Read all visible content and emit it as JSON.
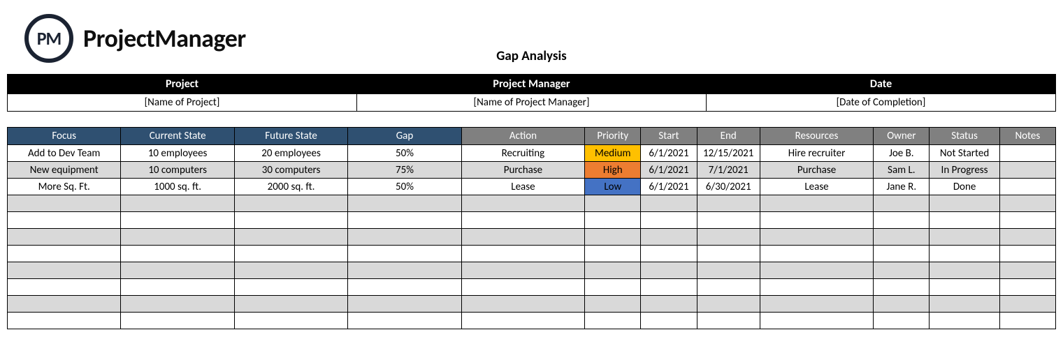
{
  "brand": {
    "logo_abbrev": "PM",
    "name": "ProjectManager"
  },
  "title": "Gap Analysis",
  "meta": {
    "headers": [
      "Project",
      "Project Manager",
      "Date"
    ],
    "values": [
      "[Name of Project]",
      "[Name of Project Manager]",
      "[Date of Completion]"
    ]
  },
  "columns": [
    {
      "key": "focus",
      "label": "Focus",
      "group": "blue"
    },
    {
      "key": "current",
      "label": "Current State",
      "group": "blue"
    },
    {
      "key": "future",
      "label": "Future State",
      "group": "blue"
    },
    {
      "key": "gap",
      "label": "Gap",
      "group": "blue"
    },
    {
      "key": "action",
      "label": "Action",
      "group": "gray"
    },
    {
      "key": "priority",
      "label": "Priority",
      "group": "gray"
    },
    {
      "key": "start",
      "label": "Start",
      "group": "gray"
    },
    {
      "key": "end",
      "label": "End",
      "group": "gray"
    },
    {
      "key": "resources",
      "label": "Resources",
      "group": "gray"
    },
    {
      "key": "owner",
      "label": "Owner",
      "group": "gray"
    },
    {
      "key": "status",
      "label": "Status",
      "group": "gray"
    },
    {
      "key": "notes",
      "label": "Notes",
      "group": "gray"
    }
  ],
  "rows": [
    {
      "stripe": "white",
      "focus": "Add to Dev Team",
      "current": "10 employees",
      "future": "20 employees",
      "gap": "50%",
      "action": "Recruiting",
      "priority": "Medium",
      "priority_color": "medium",
      "start": "6/1/2021",
      "end": "12/15/2021",
      "resources": "Hire recruiter",
      "owner": "Joe B.",
      "status": "Not Started",
      "notes": ""
    },
    {
      "stripe": "gray",
      "focus": "New equipment",
      "current": "10 computers",
      "future": "30 computers",
      "gap": "75%",
      "action": "Purchase",
      "priority": "High",
      "priority_color": "high",
      "start": "6/1/2021",
      "end": "7/1/2021",
      "resources": "Purchase",
      "owner": "Sam L.",
      "status": "In Progress",
      "notes": ""
    },
    {
      "stripe": "white",
      "focus": "More Sq. Ft.",
      "current": "1000 sq. ft.",
      "future": "2000 sq. ft.",
      "gap": "50%",
      "action": "Lease",
      "priority": "Low",
      "priority_color": "low",
      "start": "6/1/2021",
      "end": "6/30/2021",
      "resources": "Lease",
      "owner": "Jane R.",
      "status": "Done",
      "notes": ""
    }
  ],
  "empty_rows": 8
}
